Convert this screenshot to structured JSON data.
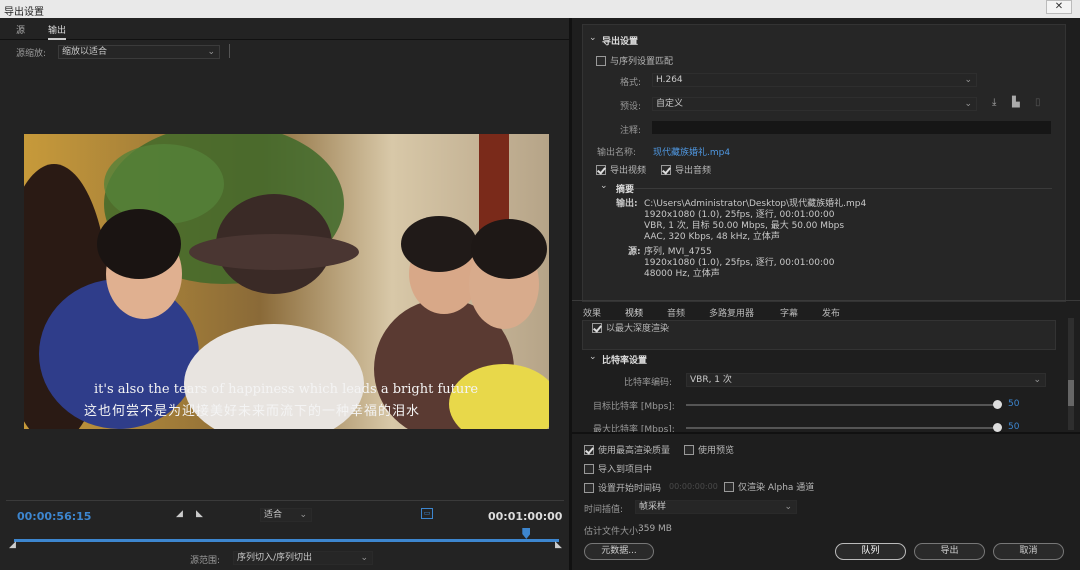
{
  "window": {
    "title": "导出设置",
    "close": "✕"
  },
  "left": {
    "tabs": [
      "源",
      "输出"
    ],
    "source_scale_label": "源缩放:",
    "source_scale_value": "缩放以适合",
    "subtitle_en": "it's also the tears of happiness which leads a bright future",
    "subtitle_cn": "这也何尝不是为迎接美好未来而流下的一种幸福的泪水",
    "timecode_current": "00:00:56:15",
    "fit_value": "适合",
    "timecode_end": "00:01:00:00",
    "playhead_fraction": 0.94,
    "range_label": "源范围:",
    "range_value": "序列切入/序列切出"
  },
  "export": {
    "section_title": "导出设置",
    "match_seq": "与序列设置匹配",
    "format_label": "格式:",
    "format_value": "H.264",
    "preset_label": "预设:",
    "preset_value": "自定义",
    "comment_label": "注释:",
    "output_name_label": "输出名称:",
    "output_name_value": "现代藏族婚礼.mp4",
    "export_video": "导出视频",
    "export_audio": "导出音频",
    "summary_title": "摘要",
    "output_label": "输出:",
    "output_lines": [
      "C:\\Users\\Administrator\\Desktop\\现代藏族婚礼.mp4",
      "1920x1080 (1.0), 25fps, 逐行, 00:01:00:00",
      "VBR, 1 次, 目标 50.00 Mbps, 最大 50.00 Mbps",
      "AAC, 320 Kbps, 48 kHz, 立体声"
    ],
    "source_label": "源:",
    "source_lines": [
      "序列, MVI_4755",
      "1920x1080 (1.0), 25fps, 逐行, 00:01:00:00",
      "48000 Hz, 立体声"
    ]
  },
  "settings_tabs": [
    "效果",
    "视频",
    "音频",
    "多路复用器",
    "字幕",
    "发布"
  ],
  "video": {
    "max_depth": "以最大深度渲染",
    "bitrate_title": "比特率设置",
    "bitrate_enc_label": "比特率编码:",
    "bitrate_enc_value": "VBR, 1 次",
    "target_label": "目标比特率 [Mbps]:",
    "target_value": "50",
    "max_label": "最大比特率 [Mbps]:",
    "max_value": "50"
  },
  "bottom": {
    "max_quality": "使用最高渲染质量",
    "use_preview": "使用预览",
    "import_project": "导入到项目中",
    "set_start_tc": "设置开始时间码",
    "start_tc_value": "00:00:00:00",
    "alpha_only": "仅渲染 Alpha 通道",
    "interp_label": "时间插值:",
    "interp_value": "帧采样",
    "filesize_label": "估计文件大小:",
    "filesize_value": "359 MB",
    "metadata": "元数据...",
    "queue": "队列",
    "export": "导出",
    "cancel": "取消"
  },
  "colors": {
    "accent": "#3d86cf",
    "bg": "#1e1e1e"
  }
}
